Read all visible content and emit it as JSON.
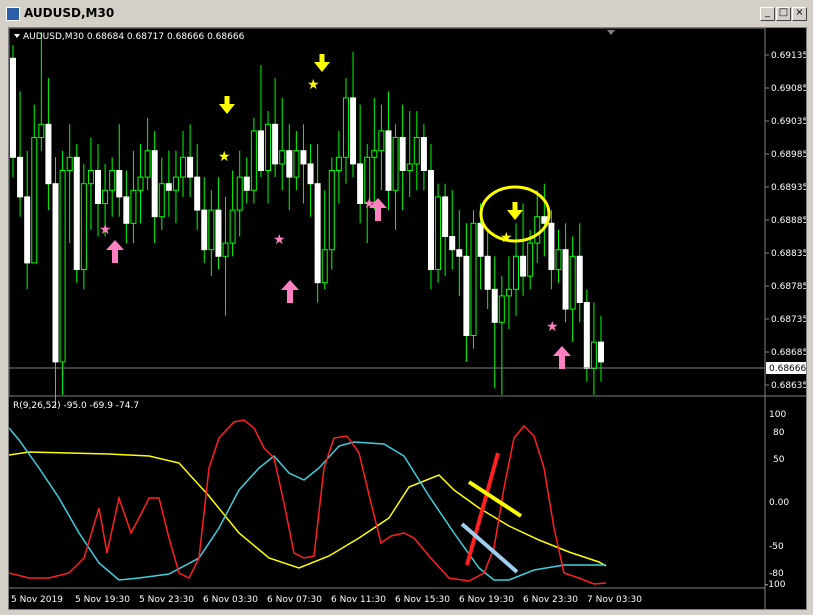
{
  "window": {
    "title": "AUDUSD,M30",
    "buttons": [
      "_",
      "□",
      "×"
    ]
  },
  "main_chart": {
    "header": "AUDUSD,M30  0.68684 0.68717 0.68666 0.68666",
    "price_labels": [
      "0.69135",
      "0.69085",
      "0.69035",
      "0.68985",
      "0.68935",
      "0.68885",
      "0.68835",
      "0.68785",
      "0.68735",
      "0.68685",
      "0.68635"
    ],
    "current_price": "0.68666"
  },
  "indicator": {
    "header": "R(9,26,52) -95.0 -69.9 -74.7",
    "levels": [
      "100",
      "80",
      "50",
      "0.00",
      "-50",
      "-80",
      "-100"
    ]
  },
  "time_labels": [
    "5 Nov 2019",
    "5 Nov 19:30",
    "5 Nov 23:30",
    "6 Nov 03:30",
    "6 Nov 07:30",
    "6 Nov 11:30",
    "6 Nov 15:30",
    "6 Nov 19:30",
    "6 Nov 23:30",
    "7 Nov 03:30"
  ],
  "colors": {
    "background": "#000000",
    "bull_candle": "#00ff00",
    "bear_candle": "#ffffff",
    "grid": "#808080",
    "yellow": "#ffff00",
    "pink": "#ff80c0",
    "red": "#ff2020",
    "cyan": "#40d0e0",
    "light_blue": "#a0d0f0"
  },
  "chart_data": {
    "type": "candlestick",
    "title": "AUDUSD,M30",
    "ylim": [
      0.68635,
      0.69155
    ],
    "candles": [
      [
        0.6913,
        0.6915,
        0.6895,
        0.6898
      ],
      [
        0.6898,
        0.6908,
        0.6889,
        0.6892
      ],
      [
        0.6892,
        0.6899,
        0.6878,
        0.6882
      ],
      [
        0.6882,
        0.6906,
        0.6882,
        0.6901
      ],
      [
        0.6901,
        0.6917,
        0.6899,
        0.6903
      ],
      [
        0.6903,
        0.691,
        0.689,
        0.6894
      ],
      [
        0.6894,
        0.6898,
        0.686,
        0.6867
      ],
      [
        0.6867,
        0.6899,
        0.6862,
        0.6896
      ],
      [
        0.6896,
        0.6903,
        0.6885,
        0.6898
      ],
      [
        0.6898,
        0.69,
        0.6879,
        0.6881
      ],
      [
        0.6881,
        0.6897,
        0.6878,
        0.6894
      ],
      [
        0.6894,
        0.6901,
        0.6887,
        0.6896
      ],
      [
        0.6896,
        0.69,
        0.6886,
        0.6891
      ],
      [
        0.6891,
        0.6897,
        0.6886,
        0.6893
      ],
      [
        0.6893,
        0.6898,
        0.6889,
        0.6896
      ],
      [
        0.6896,
        0.6903,
        0.6889,
        0.6892
      ],
      [
        0.6892,
        0.6896,
        0.6885,
        0.6888
      ],
      [
        0.6888,
        0.6899,
        0.6885,
        0.6893
      ],
      [
        0.6893,
        0.69,
        0.6888,
        0.6895
      ],
      [
        0.6895,
        0.6904,
        0.6893,
        0.6899
      ],
      [
        0.6899,
        0.6902,
        0.6885,
        0.6889
      ],
      [
        0.6889,
        0.6898,
        0.6887,
        0.6894
      ],
      [
        0.6894,
        0.6899,
        0.6889,
        0.6893
      ],
      [
        0.6893,
        0.6899,
        0.6888,
        0.6895
      ],
      [
        0.6895,
        0.6902,
        0.6892,
        0.6898
      ],
      [
        0.6898,
        0.6903,
        0.6892,
        0.6895
      ],
      [
        0.6895,
        0.69,
        0.6887,
        0.689
      ],
      [
        0.689,
        0.6895,
        0.6882,
        0.6884
      ],
      [
        0.6884,
        0.6893,
        0.688,
        0.689
      ],
      [
        0.689,
        0.6895,
        0.6881,
        0.6883
      ],
      [
        0.6883,
        0.6892,
        0.6874,
        0.6885
      ],
      [
        0.6885,
        0.6896,
        0.6883,
        0.689
      ],
      [
        0.689,
        0.6899,
        0.6886,
        0.6895
      ],
      [
        0.6895,
        0.6898,
        0.6891,
        0.6893
      ],
      [
        0.6893,
        0.6904,
        0.6891,
        0.6902
      ],
      [
        0.6902,
        0.6912,
        0.6895,
        0.6896
      ],
      [
        0.6896,
        0.6905,
        0.6891,
        0.6903
      ],
      [
        0.6903,
        0.691,
        0.6895,
        0.6897
      ],
      [
        0.6897,
        0.6907,
        0.6893,
        0.6899
      ],
      [
        0.6899,
        0.6903,
        0.689,
        0.6895
      ],
      [
        0.6895,
        0.6902,
        0.6893,
        0.6899
      ],
      [
        0.6899,
        0.6903,
        0.6891,
        0.6897
      ],
      [
        0.6897,
        0.69,
        0.6889,
        0.6894
      ],
      [
        0.6894,
        0.69,
        0.6876,
        0.6879
      ],
      [
        0.6879,
        0.6893,
        0.6878,
        0.6884
      ],
      [
        0.6884,
        0.6898,
        0.6881,
        0.6896
      ],
      [
        0.6896,
        0.6902,
        0.6891,
        0.6898
      ],
      [
        0.6898,
        0.691,
        0.6894,
        0.6907
      ],
      [
        0.6907,
        0.6914,
        0.6895,
        0.6897
      ],
      [
        0.6897,
        0.6906,
        0.6888,
        0.6891
      ],
      [
        0.6891,
        0.69,
        0.6885,
        0.6898
      ],
      [
        0.6898,
        0.6907,
        0.689,
        0.6899
      ],
      [
        0.6899,
        0.6906,
        0.6893,
        0.6902
      ],
      [
        0.6902,
        0.6908,
        0.689,
        0.6893
      ],
      [
        0.6893,
        0.6903,
        0.6887,
        0.6901
      ],
      [
        0.6901,
        0.6906,
        0.689,
        0.6896
      ],
      [
        0.6896,
        0.6905,
        0.6892,
        0.6897
      ],
      [
        0.6897,
        0.6905,
        0.6893,
        0.6901
      ],
      [
        0.6901,
        0.6903,
        0.6893,
        0.6896
      ],
      [
        0.6896,
        0.69,
        0.6878,
        0.6881
      ],
      [
        0.6881,
        0.6894,
        0.6879,
        0.6892
      ],
      [
        0.6892,
        0.6894,
        0.688,
        0.6886
      ],
      [
        0.6886,
        0.6893,
        0.6881,
        0.6884
      ],
      [
        0.6884,
        0.689,
        0.6877,
        0.6883
      ],
      [
        0.6883,
        0.6888,
        0.6867,
        0.6871
      ],
      [
        0.6871,
        0.689,
        0.6869,
        0.6888
      ],
      [
        0.6888,
        0.6891,
        0.6878,
        0.6883
      ],
      [
        0.6883,
        0.6887,
        0.6875,
        0.6878
      ],
      [
        0.6878,
        0.6883,
        0.6863,
        0.6873
      ],
      [
        0.6873,
        0.688,
        0.6862,
        0.6877
      ],
      [
        0.6877,
        0.6883,
        0.6872,
        0.6878
      ],
      [
        0.6878,
        0.6888,
        0.6874,
        0.6883
      ],
      [
        0.6883,
        0.6891,
        0.6877,
        0.688
      ],
      [
        0.688,
        0.6887,
        0.6878,
        0.6885
      ],
      [
        0.6885,
        0.6893,
        0.6882,
        0.6889
      ],
      [
        0.6889,
        0.6894,
        0.6883,
        0.6888
      ],
      [
        0.6888,
        0.689,
        0.6878,
        0.6881
      ],
      [
        0.6881,
        0.6887,
        0.6879,
        0.6884
      ],
      [
        0.6884,
        0.6888,
        0.6873,
        0.6875
      ],
      [
        0.6875,
        0.6886,
        0.687,
        0.6883
      ],
      [
        0.6883,
        0.6888,
        0.6873,
        0.6876
      ],
      [
        0.6876,
        0.6878,
        0.6864,
        0.6866
      ],
      [
        0.6866,
        0.6876,
        0.6862,
        0.687
      ],
      [
        0.687,
        0.6874,
        0.6864,
        0.6867
      ]
    ]
  }
}
